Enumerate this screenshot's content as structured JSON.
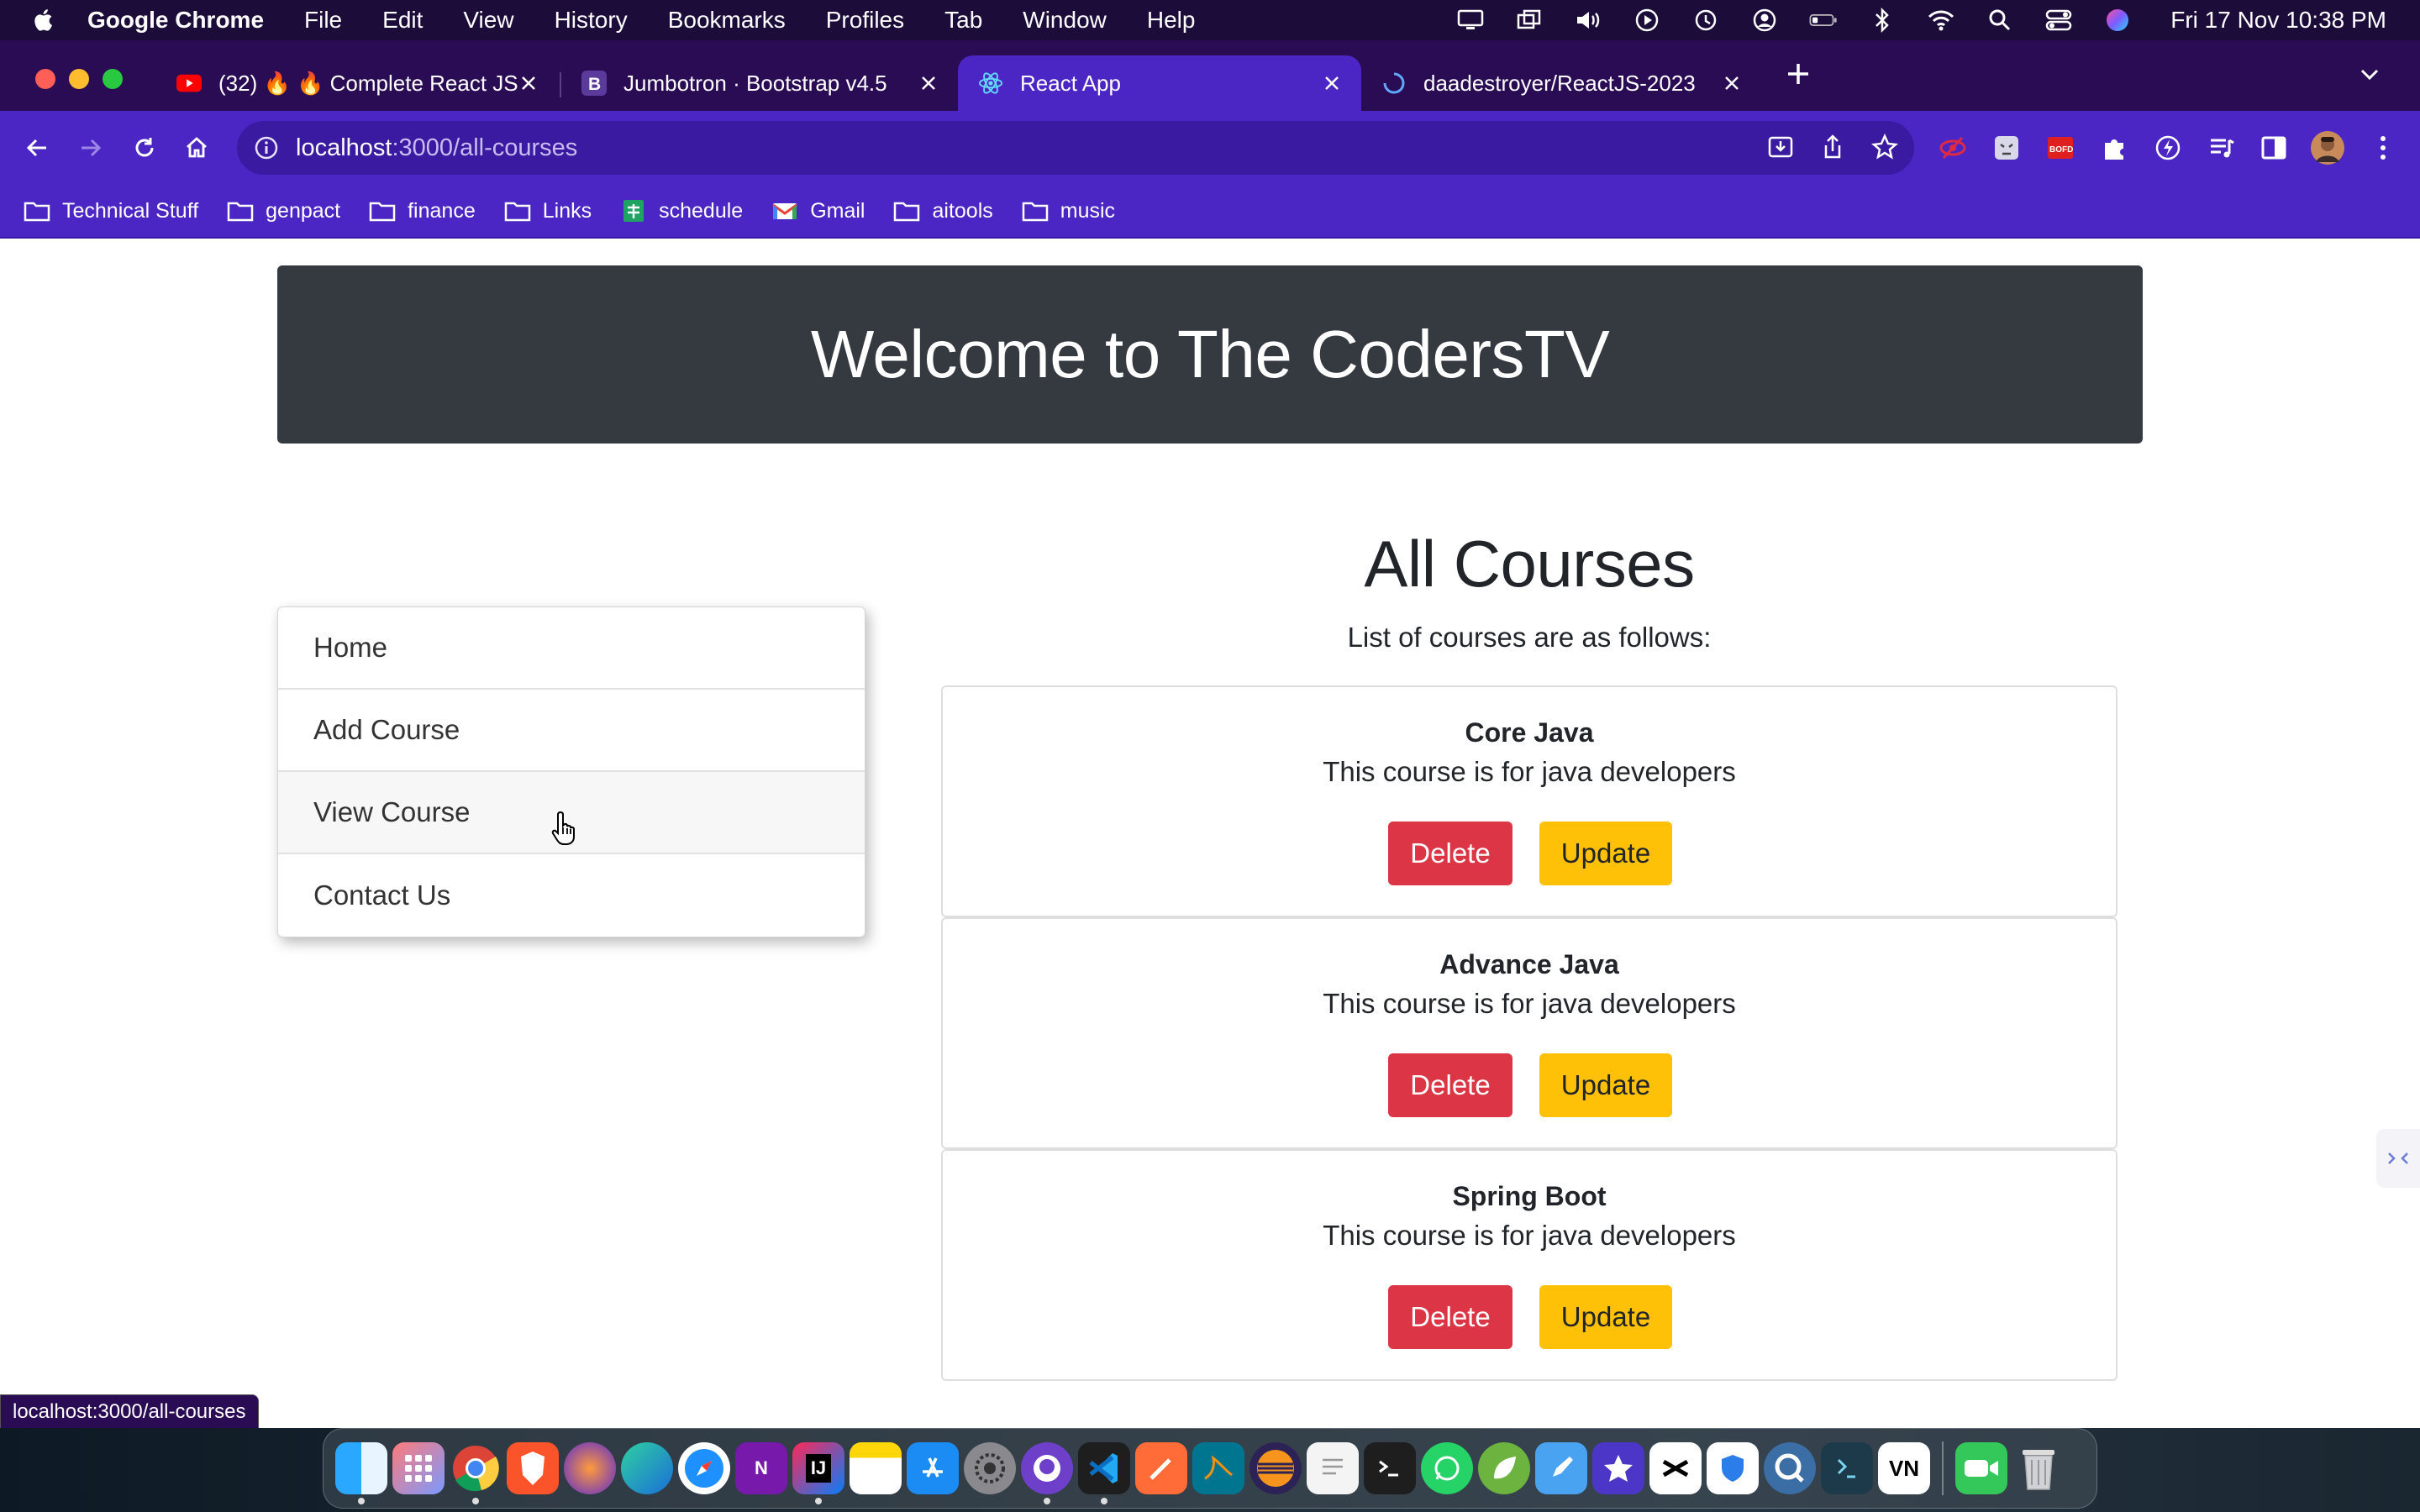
{
  "menubar": {
    "app_name": "Google Chrome",
    "menus": [
      "File",
      "Edit",
      "View",
      "History",
      "Bookmarks",
      "Profiles",
      "Tab",
      "Window",
      "Help"
    ],
    "clock": "Fri 17 Nov  10:38 PM"
  },
  "tabs": [
    {
      "title": "(32) 🔥 🔥 Complete React JS",
      "icon": "youtube-icon",
      "active": false
    },
    {
      "title": "Jumbotron · Bootstrap v4.5",
      "icon": "bootstrap-icon",
      "active": false
    },
    {
      "title": "React App",
      "icon": "react-icon",
      "active": true
    },
    {
      "title": "daadestroyer/ReactJS-2023",
      "icon": "loading-icon",
      "active": false
    }
  ],
  "address_bar": {
    "host": "localhost",
    "path": ":3000/all-courses"
  },
  "bookmarks": [
    {
      "label": "Technical Stuff",
      "icon": "folder-icon"
    },
    {
      "label": "genpact",
      "icon": "folder-icon"
    },
    {
      "label": "finance",
      "icon": "folder-icon"
    },
    {
      "label": "Links",
      "icon": "folder-icon"
    },
    {
      "label": "schedule",
      "icon": "sheets-icon"
    },
    {
      "label": "Gmail",
      "icon": "gmail-icon"
    },
    {
      "label": "aitools",
      "icon": "folder-icon"
    },
    {
      "label": "music",
      "icon": "folder-icon"
    }
  ],
  "page": {
    "jumbotron_title": "Welcome to The CodersTV",
    "menu": [
      {
        "label": "Home"
      },
      {
        "label": "Add Course"
      },
      {
        "label": "View Course"
      },
      {
        "label": "Contact Us"
      }
    ],
    "heading": "All Courses",
    "subheading": "List of courses are as follows:",
    "courses": [
      {
        "title": "Core Java",
        "description": "This course is for java developers",
        "delete_label": "Delete",
        "update_label": "Update"
      },
      {
        "title": "Advance Java",
        "description": "This course is for java developers",
        "delete_label": "Delete",
        "update_label": "Update"
      },
      {
        "title": "Spring Boot",
        "description": "This course is for java developers",
        "delete_label": "Delete",
        "update_label": "Update"
      }
    ]
  },
  "status_bar": {
    "url": "localhost:3000/all-courses"
  },
  "dock": {
    "vn_label": "VN",
    "intellij_label": "IJ"
  },
  "colors": {
    "tabstrip": "#2a0c55",
    "toolbar": "#4b26c5",
    "jumbotron": "#343a40",
    "danger": "#dc3545",
    "warning": "#ffc107"
  }
}
